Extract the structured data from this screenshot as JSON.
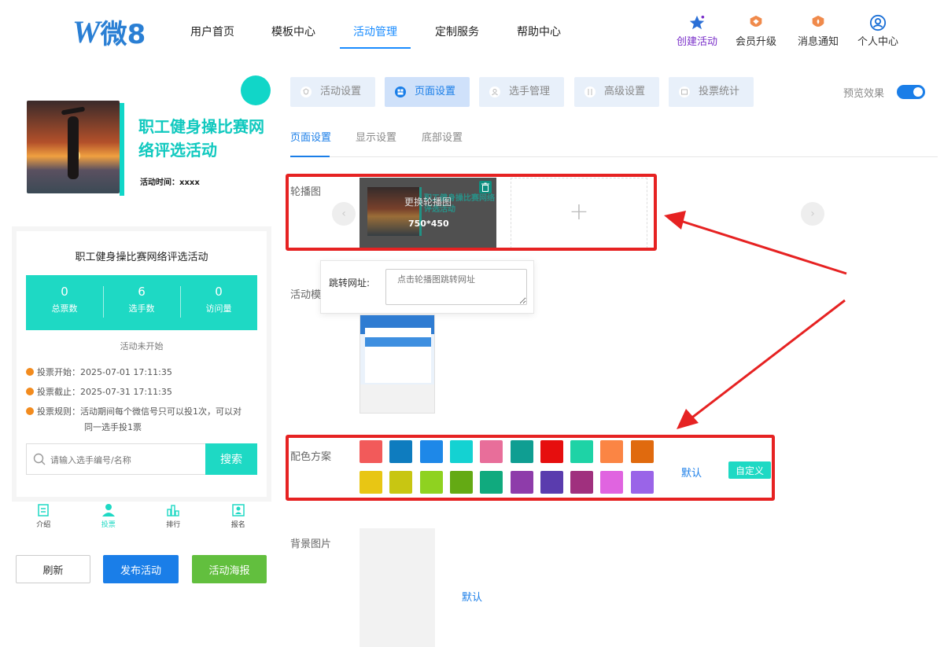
{
  "logo": {
    "mark": "W",
    "text": "微8"
  },
  "nav": {
    "items": [
      "用户首页",
      "模板中心",
      "活动管理",
      "定制服务",
      "帮助中心"
    ],
    "active_index": 2,
    "tools": [
      "创建活动",
      "会员升级",
      "消息通知",
      "个人中心"
    ]
  },
  "preview": {
    "banner_title": "职工健身操比赛网络评选活动",
    "banner_time": "活动时间：xxxx",
    "activity_title": "职工健身操比赛网络评选活动",
    "stats": [
      {
        "value": "0",
        "label": "总票数"
      },
      {
        "value": "6",
        "label": "选手数"
      },
      {
        "value": "0",
        "label": "访问量"
      }
    ],
    "status": "活动未开始",
    "rules": [
      "投票开始：2025-07-01 17:11:35",
      "投票截止：2025-07-31 17:11:35",
      "投票规则：活动期间每个微信号只可以投1次，可以对",
      "同一选手投1票"
    ],
    "search_placeholder": "请输入选手编号/名称",
    "search_button": "搜索",
    "tabbar": [
      "介绍",
      "投票",
      "排行",
      "报名"
    ],
    "tabbar_active": 1,
    "buttons": {
      "refresh": "刷新",
      "publish": "发布活动",
      "poster": "活动海报"
    }
  },
  "settings": {
    "top_tabs": [
      "活动设置",
      "页面设置",
      "选手管理",
      "高级设置",
      "投票统计"
    ],
    "top_tab_active": 1,
    "preview_label": "预览效果",
    "preview_on": true,
    "sub_tabs": [
      "页面设置",
      "显示设置",
      "底部设置"
    ],
    "sub_tab_active": 0,
    "carousel": {
      "label": "轮播图",
      "change_text": "更换轮播图",
      "size": "750*450",
      "slide_title": "职工健身操比赛网络评选活动",
      "slide_time": "活动时间：xxxx",
      "add": "+"
    },
    "jump": {
      "label": "跳转网址:",
      "placeholder": "点击轮播图跳转网址"
    },
    "template_label": "活动模",
    "color_label": "配色方案",
    "colors": [
      "#f25a5a",
      "#0e7cbf",
      "#1e88e8",
      "#14d2d2",
      "#e86e9a",
      "#0f9e92",
      "#e60e0e",
      "#1ed3a6",
      "#fb8544",
      "#e06a0e",
      "#e8c614",
      "#c8c612",
      "#8fd220",
      "#64aa14",
      "#10aa7e",
      "#8e3caa",
      "#5a3cae",
      "#a0307e",
      "#e064e0",
      "#9a64e8"
    ],
    "default_label": "默认",
    "custom_label": "自定义",
    "bg_label": "背景图片",
    "bg_default": "默认"
  }
}
